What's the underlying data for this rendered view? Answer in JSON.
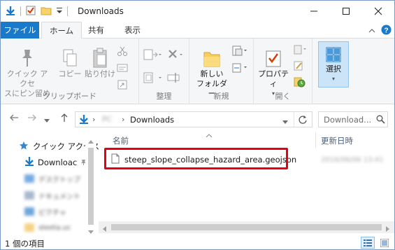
{
  "window": {
    "title": "Downloads"
  },
  "ribbon_tabs": {
    "file": "ファイル",
    "home": "ホーム",
    "share": "共有",
    "view": "表示"
  },
  "ribbon": {
    "clipboard": {
      "label": "クリップボード",
      "pin_quick_access_line1": "クイック アクセ",
      "pin_quick_access_line2": "スにピン留め",
      "copy": "コピー",
      "paste": "貼り付け"
    },
    "organize": {
      "label": "整理"
    },
    "new": {
      "label": "新規",
      "new_folder_line1": "新しい",
      "new_folder_line2": "フォルダー"
    },
    "open": {
      "label": "開く",
      "properties": "プロパティ"
    },
    "select": {
      "label": "選択",
      "select_btn": "選択"
    }
  },
  "address": {
    "path_blurred": "PC",
    "current": "Downloads",
    "search_placeholder": "Download..."
  },
  "nav_pane": {
    "quick_access": "クイック アクセス",
    "downloads": "Downloac",
    "blurred_items": [
      "デスクトップ",
      "ドキュメント",
      "ピクチャ",
      "steeta.uc"
    ]
  },
  "columns": {
    "name": "名前",
    "modified": "更新日時"
  },
  "files": [
    {
      "name": "steep_slope_collapse_hazard_area.geojson",
      "date_blurred": "2016/06/06 13:41"
    }
  ],
  "status": {
    "count": "1 個の項目"
  },
  "colors": {
    "accent": "#1979ca",
    "highlight": "#e60012"
  }
}
